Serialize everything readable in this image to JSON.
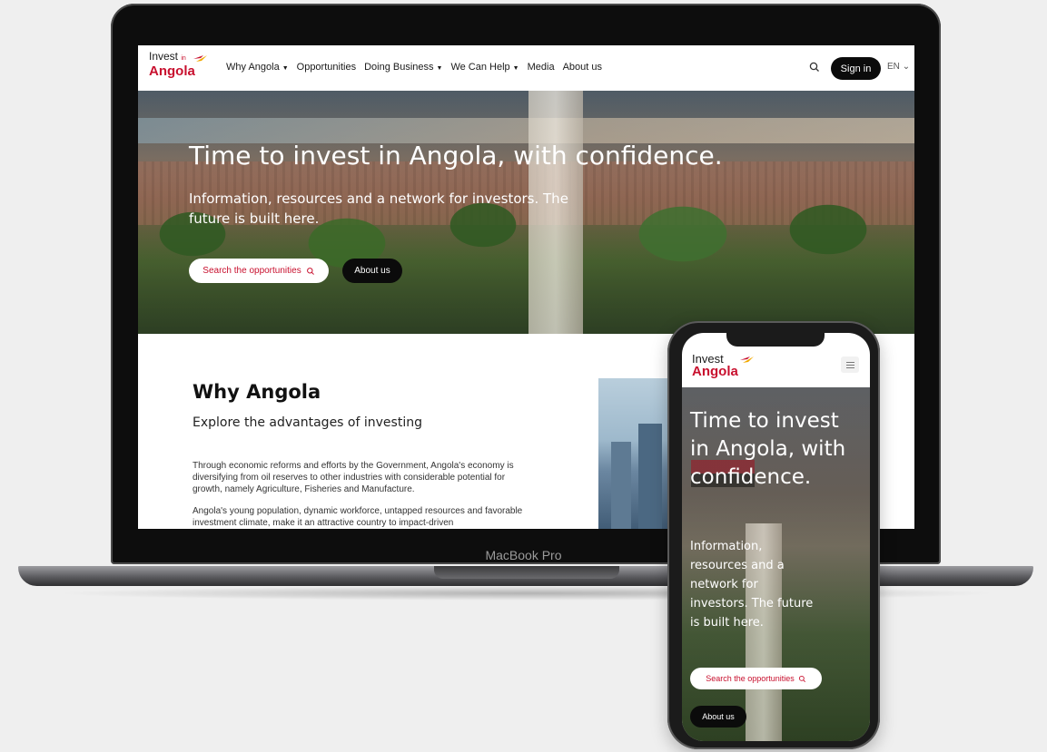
{
  "device": {
    "laptop_label": "MacBook Pro"
  },
  "desktop": {
    "logo": {
      "line1": "Invest",
      "small": "in",
      "line2": "Angola"
    },
    "nav": [
      {
        "label": "Why Angola",
        "dropdown": true
      },
      {
        "label": "Opportunities",
        "dropdown": false
      },
      {
        "label": "Doing Business",
        "dropdown": true
      },
      {
        "label": "We Can Help",
        "dropdown": true
      },
      {
        "label": "Media",
        "dropdown": false
      },
      {
        "label": "About us",
        "dropdown": false
      }
    ],
    "search_icon": "search-icon",
    "signin_label": "Sign in",
    "language": "EN",
    "hero": {
      "title": "Time to invest in Angola, with confidence.",
      "subtitle": "Information, resources and a network for investors. The future is built here.",
      "search_button": "Search the opportunities",
      "about_button": "About us"
    },
    "why": {
      "title": "Why Angola",
      "subtitle": "Explore the advantages of investing",
      "paragraph1": "Through economic reforms and efforts by the Government, Angola's economy is diversifying from oil reserves to other industries with considerable potential for growth, namely Agriculture, Fisheries and Manufacture.",
      "paragraph2": "Angola's young population, dynamic workforce, untapped resources and favorable investment climate, make it an attractive country to impact-driven"
    }
  },
  "mobile": {
    "logo": {
      "line1": "Invest",
      "line2": "Angola"
    },
    "menu_icon": "hamburger-menu-icon",
    "hero": {
      "title": "Time to invest in Angola, with confidence.",
      "subtitle": "Information, resources and a network for investors. The future is built here.",
      "search_button": "Search the opportunities",
      "about_button": "About us"
    }
  },
  "colors": {
    "brand_red": "#c8102e",
    "dark": "#0b0b0b",
    "background": "#efefef"
  }
}
